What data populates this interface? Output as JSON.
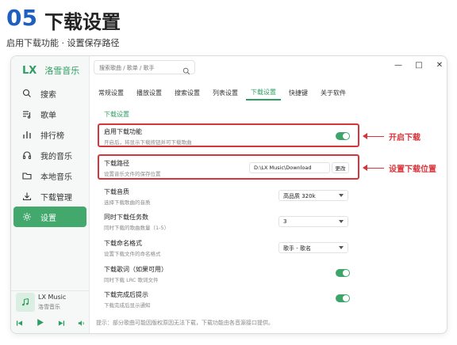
{
  "header": {
    "number": "05",
    "title": "下载设置",
    "subtitle": "启用下载功能 · 设置保存路径"
  },
  "app": {
    "logo": "LX",
    "name": "洛雪音乐"
  },
  "sidebar": {
    "items": [
      {
        "label": "搜索",
        "icon": "search-icon",
        "active": false
      },
      {
        "label": "歌单",
        "icon": "playlist-icon",
        "active": false
      },
      {
        "label": "排行榜",
        "icon": "chart-icon",
        "active": false
      },
      {
        "label": "我的音乐",
        "icon": "headphones-icon",
        "active": false
      },
      {
        "label": "本地音乐",
        "icon": "folder-icon",
        "active": false
      },
      {
        "label": "下载管理",
        "icon": "download-icon",
        "active": false
      },
      {
        "label": "设置",
        "icon": "gear-icon",
        "active": true
      }
    ]
  },
  "player": {
    "song": "LX Music",
    "artist": "洛雪音乐"
  },
  "search": {
    "placeholder": "搜索歌曲 / 歌单 / 歌手"
  },
  "window_controls": [
    "—",
    "□",
    "✕"
  ],
  "tabs": [
    {
      "label": "常规设置",
      "active": false
    },
    {
      "label": "播放设置",
      "active": false
    },
    {
      "label": "搜索设置",
      "active": false
    },
    {
      "label": "列表设置",
      "active": false
    },
    {
      "label": "下载设置",
      "active": true
    },
    {
      "label": "快捷键",
      "active": false
    },
    {
      "label": "关于软件",
      "active": false
    }
  ],
  "settings": {
    "section_label": "下载设置",
    "enable_download": {
      "title": "启用下载功能",
      "desc": "开启后，将显示下载按钮并可下载歌曲",
      "on": true
    },
    "download_path": {
      "title": "下载路径",
      "desc": "设置音乐文件的保存位置",
      "value": "D:\\LX Music\\Download",
      "button": "更改"
    },
    "quality": {
      "title": "下载音质",
      "desc": "选择下载歌曲的音质",
      "value": "高品质 320k"
    },
    "concurrent": {
      "title": "同时下载任务数",
      "desc": "同时下载的歌曲数量（1-5）",
      "value": "3"
    },
    "naming": {
      "title": "下载命名格式",
      "desc": "设置下载文件的命名格式",
      "value": "歌手 - 歌名"
    },
    "lyrics": {
      "title": "下载歌词（如果可用）",
      "desc": "同时下载 LRC 歌词文件",
      "on": true
    },
    "notify": {
      "title": "下载完成后提示",
      "desc": "下载完成后显示通知",
      "on": true
    }
  },
  "annotations": {
    "enable": "开启下载",
    "path": "设置下载位置"
  },
  "footer_tip": "提示：部分歌曲可能因版权原因无法下载，下载功能由各音源接口提供。",
  "colors": {
    "accent": "#2f9e63",
    "highlight": "#d8343a",
    "header_number": "#1f5fbf"
  }
}
